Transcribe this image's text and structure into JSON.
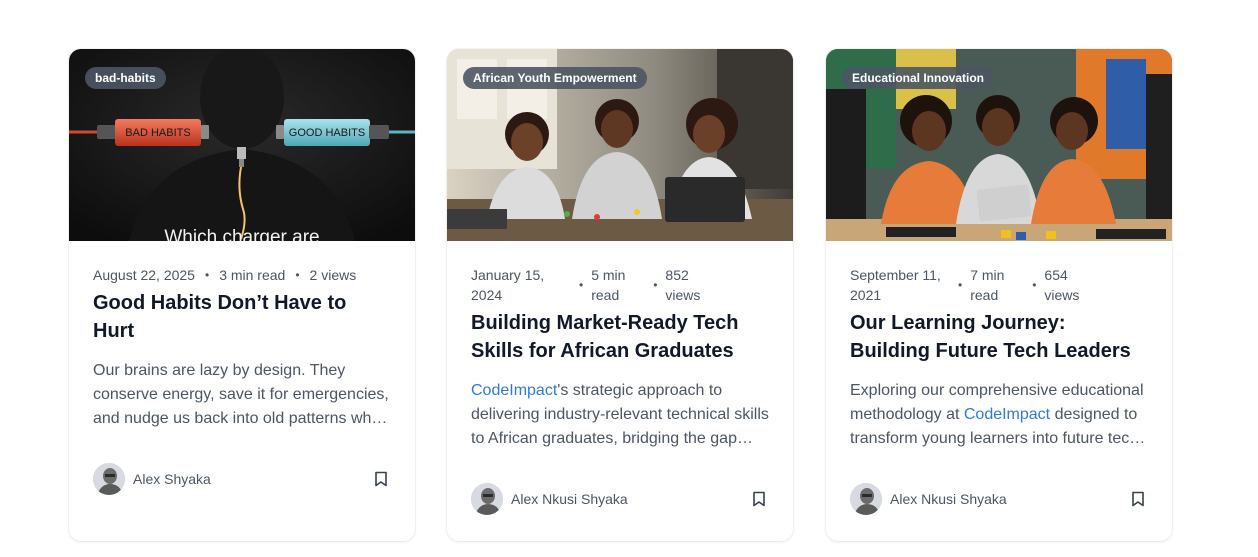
{
  "posts": [
    {
      "tag": "bad-habits",
      "image_text": {
        "left_battery": "BAD HABITS",
        "right_battery": "GOOD HABITS",
        "caption": "Which charger are"
      },
      "date": "August 22, 2025",
      "read_time": "3 min read",
      "views": "2 views",
      "title": "Good Habits Don’t Have to Hurt",
      "excerpt": "Our brains are lazy by design. They conserve energy, save it for emergencies, and nudge us back into old patterns when we try to change.",
      "author": "Alex Shyaka"
    },
    {
      "tag": "African Youth Empowerment",
      "date": "January 15, 2024",
      "read_time": "5 min read",
      "views": "852 views",
      "title": "Building Market-Ready Tech Skills for African Graduates",
      "excerpt_link": "CodeImpact",
      "excerpt_rest": "'s strategic approach to delivering industry-relevant technical skills to African graduates, bridging the gap between education and employment.",
      "author": "Alex Nkusi Shyaka"
    },
    {
      "tag": "Educational Innovation",
      "date": "September 11, 2021",
      "read_time": "7 min read",
      "views": "654 views",
      "title": "Our Learning Journey: Building Future Tech Leaders",
      "excerpt_before": "Exploring our comprehensive educational methodology at ",
      "excerpt_link": "CodeImpact",
      "excerpt_after": " designed to transform young learners into future tech leaders.",
      "author": "Alex Nkusi Shyaka"
    }
  ],
  "icons": {
    "bookmark": "bookmark-icon",
    "avatar": "avatar"
  },
  "colors": {
    "link": "#2f7bd8",
    "tag_bg": "#4b5563"
  }
}
